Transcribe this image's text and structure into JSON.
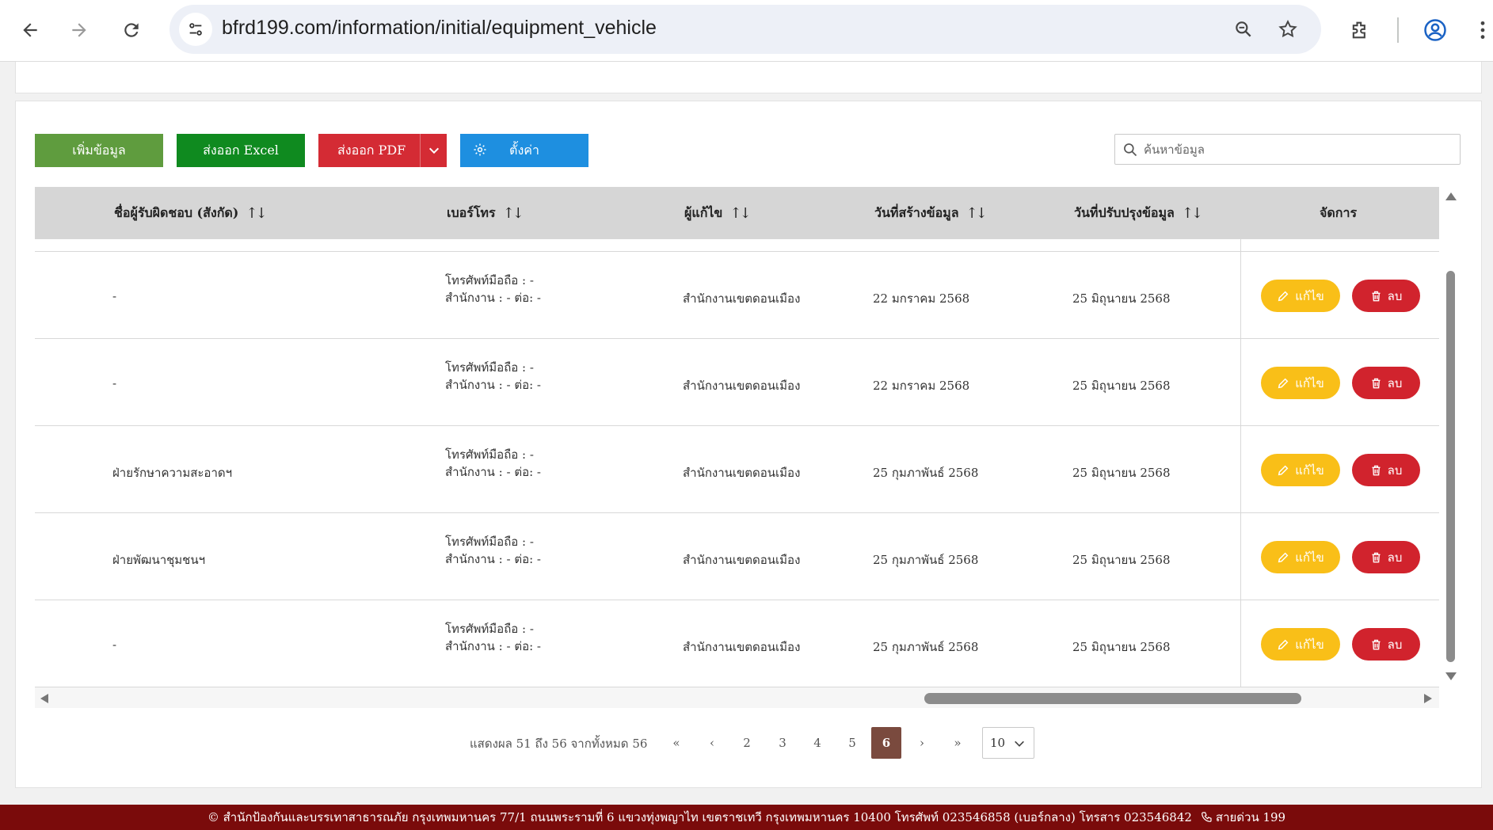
{
  "browser": {
    "url": "bfrd199.com/information/initial/equipment_vehicle"
  },
  "toolbar": {
    "add_label": "เพิ่มข้อมูล",
    "excel_label": "ส่งออก Excel",
    "pdf_label": "ส่งออก PDF",
    "settings_label": "ตั้งค่า",
    "search_placeholder": "ค้นหาข้อมูล"
  },
  "table": {
    "headers": {
      "owner": "ชื่อผู้รับผิดชอบ (สังกัด)",
      "phone": "เบอร์โทร",
      "editor": "ผู้แก้ไข",
      "created": "วันที่สร้างข้อมูล",
      "updated": "วันที่ปรับปรุงข้อมูล",
      "manage": "จัดการ"
    },
    "rows": [
      {
        "owner": "-",
        "mobile": "โทรศัพท์มือถือ : -",
        "office": "สำนักงาน : - ต่อ: -",
        "editor": "สำนักงานเขตดอนเมือง",
        "created": "22 มกราคม 2568",
        "updated": "25 มิถุนายน 2568"
      },
      {
        "owner": "-",
        "mobile": "โทรศัพท์มือถือ : -",
        "office": "สำนักงาน : - ต่อ: -",
        "editor": "สำนักงานเขตดอนเมือง",
        "created": "22 มกราคม 2568",
        "updated": "25 มิถุนายน 2568"
      },
      {
        "owner": "ฝ่ายรักษาความสะอาดฯ",
        "mobile": "โทรศัพท์มือถือ : -",
        "office": "สำนักงาน : - ต่อ: -",
        "editor": "สำนักงานเขตดอนเมือง",
        "created": "25 กุมภาพันธ์ 2568",
        "updated": "25 มิถุนายน 2568"
      },
      {
        "owner": "ฝ่ายพัฒนาชุมชนฯ",
        "mobile": "โทรศัพท์มือถือ : -",
        "office": "สำนักงาน : - ต่อ: -",
        "editor": "สำนักงานเขตดอนเมือง",
        "created": "25 กุมภาพันธ์ 2568",
        "updated": "25 มิถุนายน 2568"
      },
      {
        "owner": "-",
        "mobile": "โทรศัพท์มือถือ : -",
        "office": "สำนักงาน : - ต่อ: -",
        "editor": "สำนักงานเขตดอนเมือง",
        "created": "25 กุมภาพันธ์ 2568",
        "updated": "25 มิถุนายน 2568"
      }
    ],
    "edit_label": "แก้ไข",
    "delete_label": "ลบ"
  },
  "pagination": {
    "info": "แสดงผล 51 ถึง 56 จากทั้งหมด 56",
    "first": "«",
    "prev": "‹",
    "pages": [
      "2",
      "3",
      "4",
      "5",
      "6"
    ],
    "current": "6",
    "next": "›",
    "last": "»",
    "page_size": "10"
  },
  "footer": {
    "text": "© สำนักป้องกันและบรรเทาสาธารณภัย กรุงเทพมหานคร 77/1 ถนนพระรามที่ 6 แขวงทุ่งพญาไท เขตราชเทวี กรุงเทพมหานคร 10400 โทรศัพท์ 023546858 (เบอร์กลาง) โทรสาร 023546842",
    "hotline": "สายด่วน 199"
  },
  "colors": {
    "add": "#5f9c3e",
    "excel": "#0f8a1f",
    "pdf": "#d42b34",
    "settings": "#1e8fe0",
    "edit": "#f9bf18",
    "delete": "#d1232d",
    "active_page": "#7a4a3e",
    "footer": "#7a0b0b"
  }
}
